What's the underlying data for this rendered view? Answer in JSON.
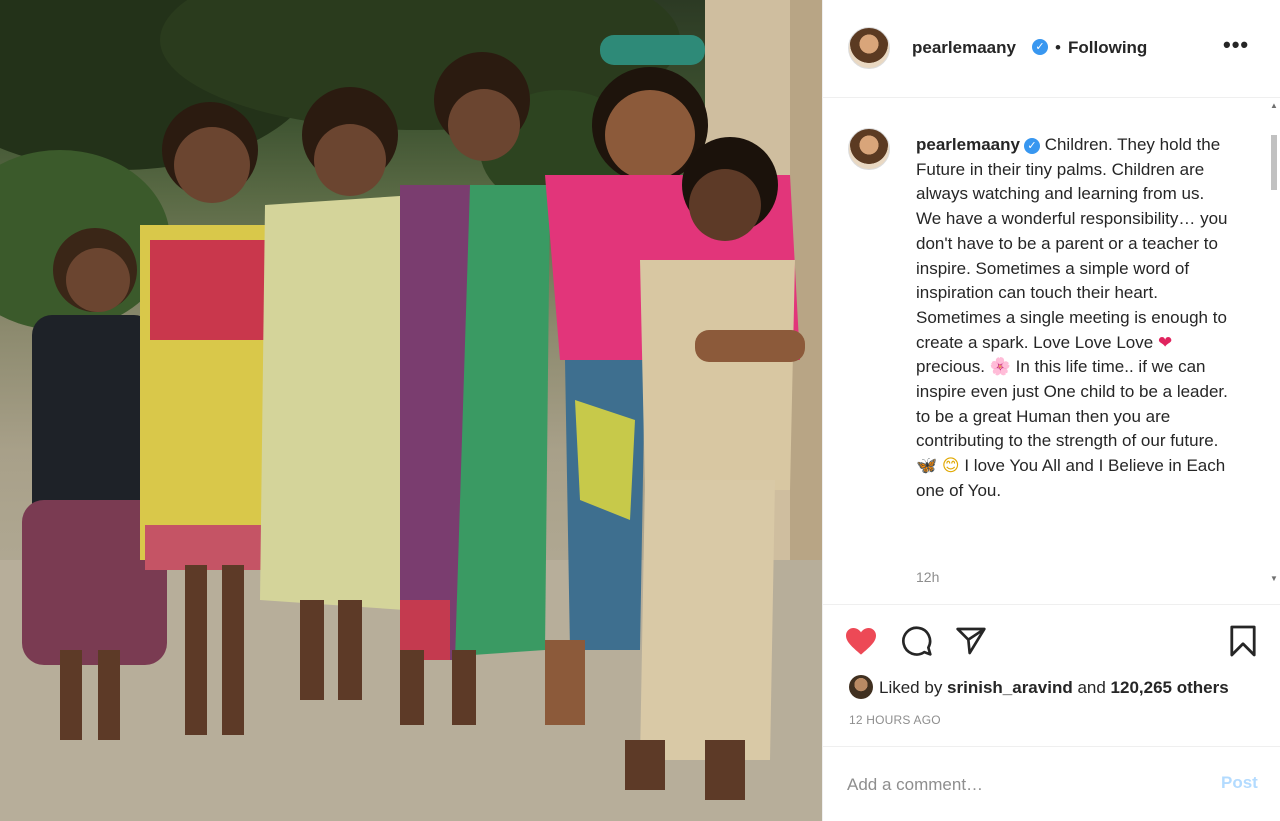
{
  "post": {
    "image_alt": "Group photo of a woman in a pink top with five children",
    "author": "pearlemaany",
    "verified_mark": "✓",
    "separator": "•",
    "follow_status": "Following",
    "more_label": "•••",
    "caption_parts": [
      "Children. They hold the Future in their tiny palms. Children are always watching and learning from us. We have a wonderful responsibility… you don't have to be a parent or a teacher to inspire. Sometimes a simple word of inspiration can touch their heart. Sometimes a single meeting is enough to create a spark. Love Love Love ",
      "❤",
      " precious. ",
      "🌸",
      " In this life time.. if we can inspire even just One child to be a leader. to be a great Human then you are contributing to the strength of our future. ",
      "🦋",
      " ",
      "😊",
      " I love You All and I Believe in Each one of You."
    ],
    "time_ago": "12h",
    "liked_by_prefix": "Liked by ",
    "liked_by_user": "srinish_aravind",
    "liked_by_and": " and ",
    "liked_by_count": "120,265 others",
    "timestamp": "12 HOURS AGO",
    "comment_placeholder": "Add a comment…",
    "post_label": "Post"
  },
  "icons": {
    "like": "heart-icon",
    "comment": "comment-icon",
    "share": "paper-plane-icon",
    "save": "bookmark-icon"
  },
  "colors": {
    "like_red": "#ed4956",
    "verified_blue": "#3897f0",
    "post_disabled": "#b3dbff",
    "muted_text": "#8e8e8e"
  }
}
